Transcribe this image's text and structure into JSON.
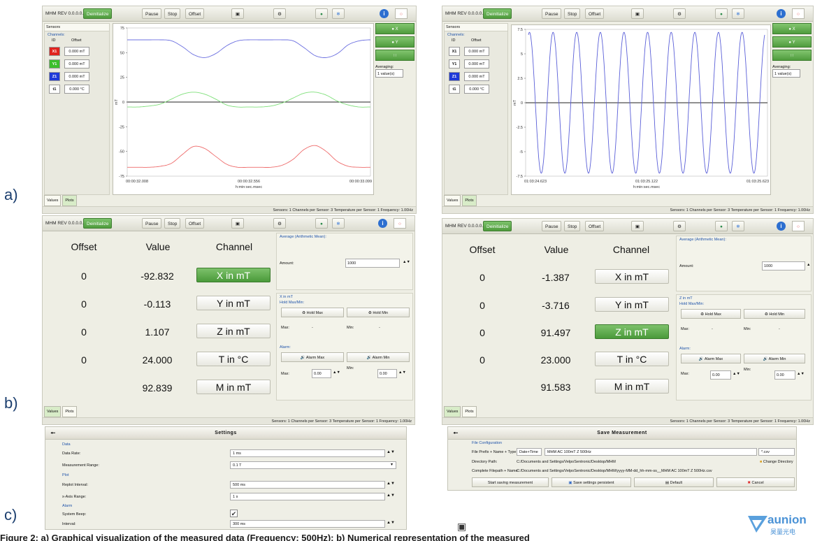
{
  "panel_labels": [
    "a)",
    "b)",
    "c)"
  ],
  "toolbar": {
    "title": "MHM REV 0.0.0.0.1",
    "deinitialize": "Deinitialize",
    "pause": "Pause",
    "stop": "Stop",
    "offset": "Offset"
  },
  "status": "Sensors: 1    Channels per Sensor: 3 Temperature per Sensor: 1    Frequency: 1.00Hz",
  "tabs": {
    "values": "Values",
    "plots": "Plots"
  },
  "sensors_panel": {
    "title": "Sensors",
    "channels": "Channels:",
    "col_id": "ID",
    "col_offset": "Offset",
    "rows": [
      {
        "id": "X1",
        "offset": "0.000 mT",
        "color": "#e0231f"
      },
      {
        "id": "Y1",
        "offset": "0.000 mT",
        "color": "#3bbf2b"
      },
      {
        "id": "Z1",
        "offset": "0.000 mT",
        "color": "#1f3ad8"
      },
      {
        "id": "t1",
        "offset": "0.000 °C",
        "color": "#ffffff"
      }
    ],
    "rows_b": [
      {
        "id": "X1",
        "offset": "0.000 mT"
      },
      {
        "id": "Y1",
        "offset": "0.000 mT"
      },
      {
        "id": "Z1",
        "offset": "0.000 mT"
      },
      {
        "id": "t1",
        "offset": "0.000 °C"
      }
    ]
  },
  "right_panel": {
    "x": "X",
    "y": "Y",
    "averaging": "Averaging:",
    "avg_value": "1 value(s)"
  },
  "chart_data": [
    {
      "type": "line",
      "ylabel": "mT",
      "xlabel": "h:min:sec.msec",
      "ylim": [
        -75,
        75
      ],
      "yticks": [
        "75",
        "50",
        "25",
        "0",
        "-25",
        "-50",
        "-75"
      ],
      "xticks": [
        "00:00:32.008",
        "00:00:32.556",
        "00:00:33.099"
      ],
      "series": [
        {
          "color": "#6b6fe0",
          "values": [
            63,
            63,
            63,
            63,
            62,
            56,
            48,
            45,
            49,
            57,
            62,
            63,
            63,
            63,
            63,
            62,
            55,
            47,
            45,
            49,
            58,
            62,
            63
          ]
        },
        {
          "color": "#7fe07a",
          "values": [
            -5,
            -5,
            -4,
            -2,
            3,
            8,
            10,
            8,
            3,
            -3,
            -5,
            -5,
            -5,
            -4,
            -1,
            4,
            9,
            10,
            7,
            1,
            -3,
            -5,
            -5
          ]
        },
        {
          "color": "#ee6a6a",
          "values": [
            -66,
            -66,
            -66,
            -65,
            -62,
            -53,
            -45,
            -47,
            -55,
            -63,
            -66,
            -66,
            -66,
            -66,
            -64,
            -58,
            -48,
            -44,
            -50,
            -60,
            -65,
            -66,
            -66
          ]
        }
      ]
    },
    {
      "type": "line",
      "ylabel": "mT",
      "xlabel": "h:min:sec.msec",
      "ylim": [
        -7.5,
        7.5
      ],
      "yticks": [
        "7.5",
        "5",
        "2.5",
        "0",
        "-2.5",
        "-5",
        "-7.5"
      ],
      "xticks": [
        "01:03:24.623",
        "01:03:25.122",
        "01:03:25.623"
      ],
      "series": [
        {
          "color": "#5a5fd8",
          "cycles": 10,
          "amplitude": 7.2
        }
      ]
    }
  ],
  "values_views": [
    {
      "headers": {
        "offset": "Offset",
        "value": "Value",
        "channel": "Channel"
      },
      "rows": [
        {
          "offset": "0",
          "value": "-92.832",
          "channel": "X in mT",
          "selected": true
        },
        {
          "offset": "0",
          "value": "-0.113",
          "channel": "Y in mT",
          "selected": false
        },
        {
          "offset": "0",
          "value": "1.107",
          "channel": "Z in mT",
          "selected": false
        },
        {
          "offset": "0",
          "value": "24.000",
          "channel": "T in °C",
          "selected": false
        },
        {
          "offset": "",
          "value": "92.839",
          "channel": "M in mT",
          "selected": false
        }
      ],
      "side": {
        "avg_title": "Average (Arithmetic Mean):",
        "amount": "Amount:",
        "amount_value": "1000",
        "section": "X in mT",
        "hold": "Hold Max/Min:",
        "hold_max": "Hold Max",
        "hold_min": "Hold Min",
        "max": "Max:",
        "min": "Min:",
        "dash": "-",
        "alarm": "Alarm:",
        "alarm_max": "Alarm Max",
        "alarm_min": "Alarm Min",
        "alarm_val": "0.00"
      }
    },
    {
      "headers": {
        "offset": "Offset",
        "value": "Value",
        "channel": "Channel"
      },
      "rows": [
        {
          "offset": "0",
          "value": "-1.387",
          "channel": "X in mT",
          "selected": false
        },
        {
          "offset": "0",
          "value": "-3.716",
          "channel": "Y in mT",
          "selected": false
        },
        {
          "offset": "0",
          "value": "91.497",
          "channel": "Z in mT",
          "selected": true
        },
        {
          "offset": "0",
          "value": "23.000",
          "channel": "T in °C",
          "selected": false
        },
        {
          "offset": "",
          "value": "91.583",
          "channel": "M in mT",
          "selected": false
        }
      ],
      "side": {
        "avg_title": "Average (Arithmetic Mean):",
        "amount": "Amount:",
        "amount_value": "1000",
        "section": "Z in mT",
        "hold": "Hold Max/Min:",
        "hold_max": "Hold Max",
        "hold_min": "Hold Min",
        "max": "Max:",
        "min": "Min:",
        "dash": "-",
        "alarm": "Alarm:",
        "alarm_max": "Alarm Max",
        "alarm_min": "Alarm Min",
        "alarm_val": "0.00"
      }
    }
  ],
  "settings": {
    "title": "Settings",
    "data": "Data",
    "data_rate": "Data Rate:",
    "data_rate_value": "1 ms",
    "measurement_range": "Measurement Range:",
    "measurement_range_value": "0.1 T",
    "plot": "Plot",
    "replot_interval": "Replot Interval:",
    "replot_interval_value": "500 ms",
    "xaxis_range": "x-Axis Range:",
    "xaxis_range_value": "1 s",
    "alarm": "Alarm",
    "system_beep": "System Beep:",
    "interval": "Interval:",
    "interval_value": "300 ms"
  },
  "save": {
    "title": "Save Measurement",
    "file_config": "File Configuration",
    "prefix_label": "File Prefix + Name + Type:",
    "prefix_select": "Date+Time",
    "name_value": "MHM AC 100mT Z 500Hz",
    "type_value": "*.csv",
    "dir_label": "Directory Path:",
    "dir_value": "C:/Documents and Settings/VelpoSentronic/Desktop/MHM",
    "change_dir": "Change Directory",
    "complete_label": "Complete Filepath + Name:",
    "complete_value": "C:/Documents and Settings/VelpoSentronic/Desktop/MHM/yyyy-MM-dd_hh-mm-ss__MHM AC 100mT Z 500Hz.csv",
    "start": "Start saving measurement",
    "persist": "Save settings persistent",
    "default": "Default",
    "cancel": "Cancel"
  },
  "caption": "Figure 2: a) Graphical visualization of the measured data (Frequency: 500Hz); b) Numerical representation of the measured",
  "logo_text": "aunion",
  "logo_sub": "昊量光电"
}
